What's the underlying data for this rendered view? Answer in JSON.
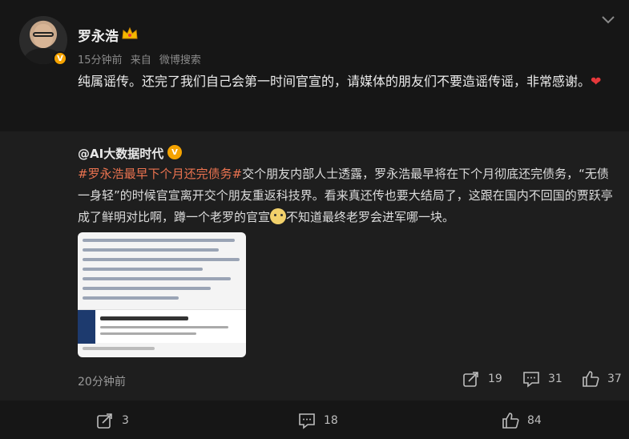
{
  "post": {
    "username": "罗永浩",
    "time": "15分钟前",
    "source_prefix": "来自",
    "source": "微博搜索",
    "text_main": "纯属谣传。还完了我们自己会第一时间官宣的，请媒体的朋友们不要造谣传谣，非常感谢。",
    "heart": "❤",
    "actions": {
      "repost": "3",
      "comment": "18",
      "like": "84"
    }
  },
  "repost": {
    "author": "@AI大数据时代",
    "hashtag": "#罗永浩最早下个月还完债务#",
    "text_1": "交个朋友内部人士透露，罗永浩最早将在下个月彻底还完债务，“无债一身轻”的时候官宣离开交个朋友重返科技界。看来真还传也要大结局了，这跟在国内不回国的贾跃亭成了鲜明对比啊，蹲一个老罗的官宣",
    "text_2": "不知道最终老罗会进军哪一块。",
    "time": "20分钟前",
    "actions": {
      "repost": "19",
      "comment": "31",
      "like": "37"
    }
  },
  "colors": {
    "background": "#161616",
    "repost_background": "#1e1e1e",
    "hashtag": "#eb7350",
    "verified": "#f5a300",
    "heart": "#e5383b"
  },
  "icons": [
    "chevron-down-icon",
    "crown-icon",
    "verified-icon",
    "repost-icon",
    "comment-icon",
    "like-icon",
    "doge-emoji"
  ]
}
